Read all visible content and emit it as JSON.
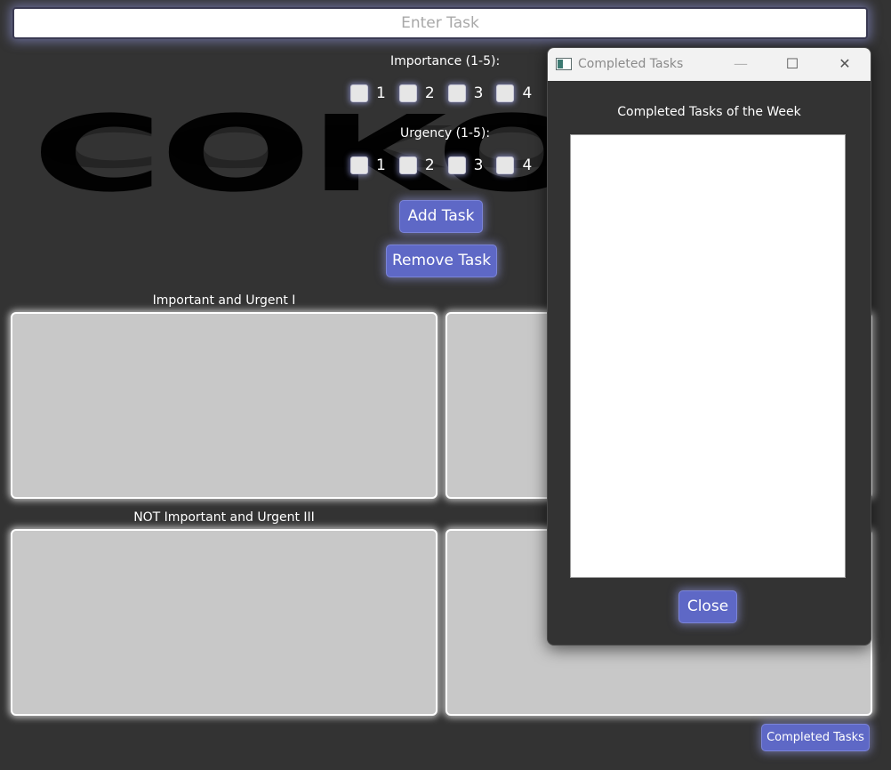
{
  "task_input": {
    "placeholder": "Enter Task"
  },
  "logo_text": "COKO",
  "importance": {
    "label": "Importance (1-5):",
    "options": [
      "1",
      "2",
      "3",
      "4"
    ]
  },
  "urgency": {
    "label": "Urgency (1-5):",
    "options": [
      "1",
      "2",
      "3",
      "4"
    ]
  },
  "buttons": {
    "add_task": "Add Task",
    "remove_task": "Remove Task",
    "completed_tasks": "Completed Tasks"
  },
  "quadrants": {
    "q1_label": "Important and Urgent I",
    "q3_label": "NOT Important and Urgent III"
  },
  "dialog": {
    "title": "Completed Tasks",
    "heading": "Completed Tasks of the Week",
    "close_label": "Close",
    "minimize_glyph": "—",
    "maximize_glyph": "☐",
    "close_glyph": "✕"
  },
  "colors": {
    "background": "#333333",
    "accent": "#5e68c6",
    "quadrant_fill": "#c8c8c8"
  }
}
